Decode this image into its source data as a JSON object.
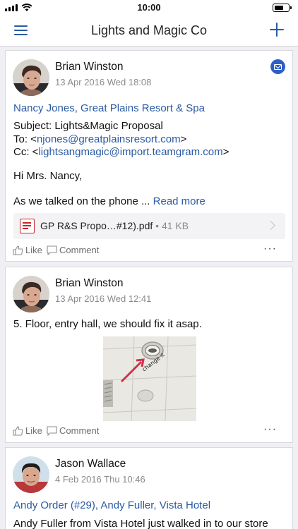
{
  "status": {
    "time": "10:00"
  },
  "header": {
    "title": "Lights and Magic Co"
  },
  "posts": [
    {
      "author": "Brian Winston",
      "date": "13 Apr 2016 Wed 18:08",
      "related": "Nancy Jones, Great Plains Resort & Spa",
      "subject": "Subject: Lights&Magic Proposal",
      "to_label": "To:  <",
      "to_email": "njones@greatplainsresort.com",
      "to_end": ">",
      "cc_label": "Cc:  <",
      "cc_email": "lightsangmagic@import.teamgram.com",
      "cc_end": ">",
      "greeting": "Hi Mrs. Nancy,",
      "body": "As we talked on the phone ...",
      "read_more": "Read more",
      "attachment": {
        "name": "GP R&S Propo…#12).pdf",
        "size": "• 41 KB"
      },
      "like_label": "Like",
      "comment_label": "Comment",
      "more_label": "···"
    },
    {
      "author": "Brian Winston",
      "date": "13 Apr 2016 Wed 12:41",
      "body": "5. Floor, entry hall, we should fix it asap.",
      "photo_caption": "change it",
      "like_label": "Like",
      "comment_label": "Comment",
      "more_label": "···"
    },
    {
      "author": "Jason Wallace",
      "date": "4 Feb 2016 Thu 10:46",
      "related": "Andy Order (#29), Andy Fuller, Vista Hotel",
      "body": "Andy Fuller from Vista Hotel just walked in to our store"
    }
  ]
}
